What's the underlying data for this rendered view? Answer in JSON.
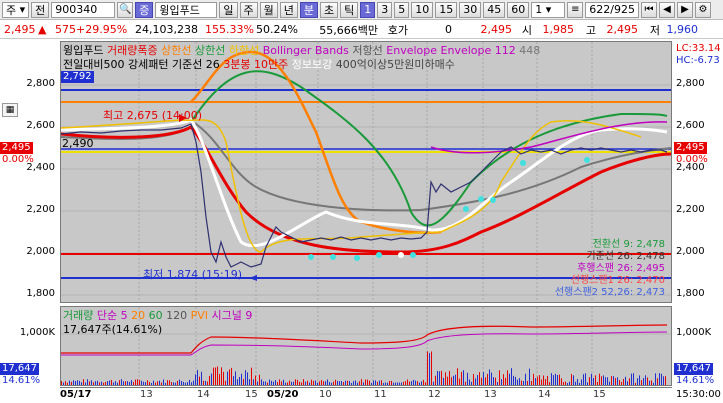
{
  "toolbar": {
    "market": "주",
    "type": "전",
    "code": "900340",
    "stock_tag": "증",
    "stock_name": "윙입푸드",
    "periods": [
      "일",
      "주",
      "월",
      "년",
      "분",
      "초",
      "틱"
    ],
    "minutes": [
      "1",
      "3",
      "5",
      "10",
      "15",
      "30",
      "45",
      "60"
    ],
    "interval_value": "1",
    "page_info": "622/925"
  },
  "quote": {
    "price": "2,495",
    "change": "575",
    "change_pct": "+29.95%",
    "volume": "24,103,238",
    "vol_ratio": "155.33%",
    "turnover": "50.24%",
    "amount": "55,666백만",
    "quote_label": "호가",
    "quote_value": "0",
    "ask_price": "2,495",
    "open_label": "시",
    "open_value": "1,985",
    "high_label": "고",
    "high_value": "2,495",
    "low_label": "저",
    "low_value": "1,960"
  },
  "price_panel": {
    "legend_line1": [
      {
        "text": "윙입푸드",
        "color": "#000000"
      },
      {
        "text": "거래량폭증",
        "color": "#e60000"
      },
      {
        "text": "상한선",
        "color": "#ff7f00"
      },
      {
        "text": "상한선",
        "color": "#1a9a3a"
      },
      {
        "text": "하한선",
        "color": "#f0c000"
      },
      {
        "text": "Bollinger Bands",
        "color": "#c000c0"
      },
      {
        "text": "저항선",
        "color": "#555555"
      },
      {
        "text": "Envelope",
        "color": "#c000c0"
      },
      {
        "text": "Envelope 112",
        "color": "#c000c0"
      },
      {
        "text": "448",
        "color": "#777777"
      }
    ],
    "legend_line2": [
      {
        "text": "전일대비500 강세패턴",
        "color": "#000000"
      },
      {
        "text": "기준선 26",
        "color": "#000000"
      },
      {
        "text": "3분봉 10만주",
        "color": "#e60000"
      },
      {
        "text": "정보보강",
        "color": "#ffffff"
      },
      {
        "text": "400억이상5만원미하매수",
        "color": "#444444"
      }
    ],
    "lc": "LC:33.14",
    "hc": "HC:-6.73",
    "ref_high": "2,792",
    "ref_price": "2,490",
    "current": "2,495",
    "current_pct": "0.00%",
    "high_note": "최고 2,675 (14:00)",
    "low_note": "최저 1,874 (15:19)",
    "y_ticks": [
      "2,800",
      "2,600",
      "2,400",
      "2,200",
      "2,000",
      "1,800"
    ],
    "indicator_labels": [
      {
        "text": "전환선 9: 2,478",
        "color": "#1a9a3a"
      },
      {
        "text": "기준선 26: 2,478",
        "color": "#333333"
      },
      {
        "text": "후행스팬 26: 2,495",
        "color": "#c000c0"
      },
      {
        "text": "선행스팬1 26: 2,470",
        "color": "#ff4040"
      },
      {
        "text": "선행스팬2 52,26: 2,473",
        "color": "#4060e0"
      }
    ]
  },
  "volume_panel": {
    "legend": [
      {
        "text": "거래량",
        "color": "#1a9a3a"
      },
      {
        "text": "단순 5",
        "color": "#c000c0"
      },
      {
        "text": "20",
        "color": "#ff7f00"
      },
      {
        "text": "60",
        "color": "#1a9a3a"
      },
      {
        "text": "120",
        "color": "#555555"
      },
      {
        "text": "PVI",
        "color": "#ff7f00"
      },
      {
        "text": "시그널 9",
        "color": "#c000c0"
      }
    ],
    "sub_label": "17,647주(14.61%)",
    "y_tick": "1,000K",
    "current": "17,647",
    "current_pct": "14.61%"
  },
  "x_axis": {
    "labels": [
      "05/17",
      "13",
      "14",
      "15",
      "05/20",
      "10",
      "11",
      "12",
      "13",
      "14",
      "15"
    ],
    "corner": "15:30:00"
  },
  "colors": {
    "accent_red": "#e60000",
    "accent_blue": "#1f2fd0",
    "panel_bg": "#c8c8c8"
  }
}
